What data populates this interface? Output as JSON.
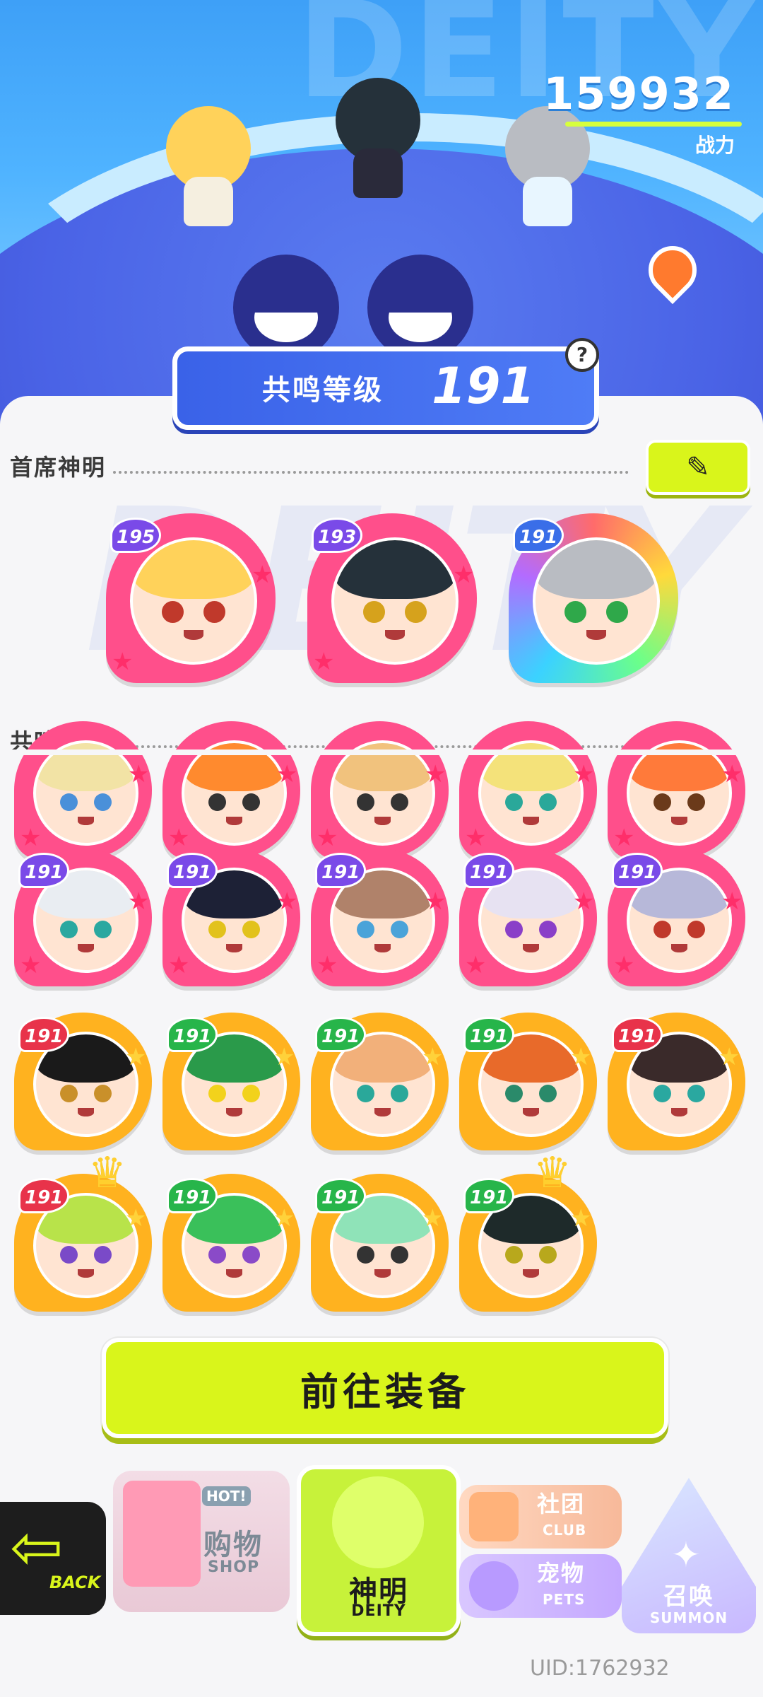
{
  "header": {
    "bg_text": "DEITY",
    "power_value": "159932",
    "power_label": "战力",
    "resonance_label": "共鸣等级",
    "resonance_level": "191",
    "help_icon": "?"
  },
  "sections": {
    "chief": "首席神明",
    "resonance": "共鸣神明"
  },
  "chief_deities": [
    {
      "level": "195",
      "frame": "pink",
      "hair": "#ffd25a",
      "eye": "#c0392b"
    },
    {
      "level": "193",
      "frame": "pink",
      "hair": "#25313a",
      "eye": "#d6a21c"
    },
    {
      "level": "191",
      "frame": "rainbow",
      "hair": "#b9bcc2",
      "eye": "#2fa84a"
    }
  ],
  "resonance_rows": [
    [
      {
        "level": "",
        "frame": "pink",
        "hair": "#f2e3a5",
        "eye": "#4a90d9"
      },
      {
        "level": "",
        "frame": "pink",
        "hair": "#ff8a2e",
        "eye": "#333333"
      },
      {
        "level": "",
        "frame": "pink",
        "hair": "#f1c27d",
        "eye": "#333333"
      },
      {
        "level": "",
        "frame": "pink",
        "hair": "#f4e27a",
        "eye": "#2aa89a"
      },
      {
        "level": "",
        "frame": "pink",
        "hair": "#ff7a3a",
        "eye": "#6b3a1a"
      }
    ],
    [
      {
        "level": "191",
        "frame": "pink",
        "hair": "#e9edf2",
        "eye": "#2aa8a0"
      },
      {
        "level": "191",
        "frame": "pink",
        "hair": "#1d2136",
        "eye": "#e2c21c"
      },
      {
        "level": "191",
        "frame": "pink",
        "hair": "#b0826a",
        "eye": "#4aa3d9"
      },
      {
        "level": "191",
        "frame": "pink",
        "hair": "#e7e2f2",
        "eye": "#8a3fc8"
      },
      {
        "level": "191",
        "frame": "pink",
        "hair": "#b7b8d9",
        "eye": "#c0392b"
      }
    ],
    [
      {
        "level": "191",
        "frame": "gold",
        "hair": "#1a1a1a",
        "eye": "#c9902a"
      },
      {
        "level": "191",
        "frame": "gold",
        "hair": "#2a9a4a",
        "eye": "#f2d21c"
      },
      {
        "level": "191",
        "frame": "gold",
        "hair": "#f2b07a",
        "eye": "#2aa89a"
      },
      {
        "level": "191",
        "frame": "gold",
        "hair": "#e86a2a",
        "eye": "#2a8a6a"
      },
      {
        "level": "191",
        "frame": "gold",
        "hair": "#3a2a2a",
        "eye": "#2aa8a0"
      }
    ],
    [
      {
        "level": "191",
        "frame": "gold",
        "hair": "#b8e34a",
        "eye": "#7a4ac8",
        "crown": true
      },
      {
        "level": "191",
        "frame": "gold",
        "hair": "#3ac05a",
        "eye": "#8a4ac8"
      },
      {
        "level": "191",
        "frame": "gold",
        "hair": "#8fe3b8",
        "eye": "#333333"
      },
      {
        "level": "191",
        "frame": "gold",
        "hair": "#1e2a2a",
        "eye": "#b8a81c",
        "crown": true
      }
    ]
  ],
  "go_button": "前往装备",
  "nav": {
    "back": "BACK",
    "shop_cn": "购物",
    "shop_en": "SHOP",
    "shop_hot": "HOT!",
    "deity_cn": "神明",
    "deity_en": "DEITY",
    "club_cn": "社团",
    "club_en": "CLUB",
    "pets_cn": "宠物",
    "pets_en": "PETS",
    "summon_cn": "召唤",
    "summon_en": "SUMMON"
  },
  "uid": "UID:1762932",
  "colors": {
    "pink_frame": "#ff4f8b",
    "gold_frame": "#ffb21f",
    "accent": "#d9f51b",
    "badge_blue": "#3a6ee8",
    "badge_purple": "#7a4ae8",
    "badge_green": "#27b54a",
    "badge_red": "#e8334a"
  }
}
